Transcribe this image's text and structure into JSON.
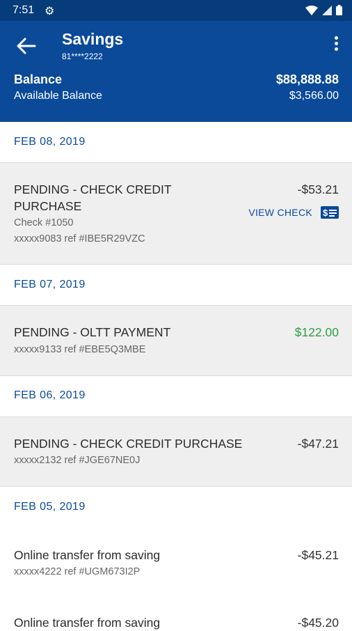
{
  "status": {
    "time": "7:51"
  },
  "header": {
    "title": "Savings",
    "account_masked": "81****2222",
    "balance_label": "Balance",
    "balance_value": "$88,888.88",
    "available_label": "Available Balance",
    "available_value": "$3,566.00"
  },
  "view_check_label": "VIEW CHECK",
  "groups": [
    {
      "date": "FEB 08, 2019",
      "transactions": [
        {
          "description_lines": [
            "PENDING - CHECK CREDIT",
            "PURCHASE"
          ],
          "check": "Check #1050",
          "ref": "xxxxx9083 ref #IBE5R29VZC",
          "amount": "-$53.21"
        }
      ]
    },
    {
      "date": "FEB 07, 2019",
      "transactions": [
        {
          "description": "PENDING - OLTT PAYMENT",
          "ref": "xxxxx9133 ref #EBE5Q3MBE",
          "amount": "$122.00"
        }
      ]
    },
    {
      "date": "FEB 06, 2019",
      "transactions": [
        {
          "description": "PENDING - CHECK CREDIT PURCHASE",
          "ref": "xxxxx2132 ref #JGE67NE0J",
          "amount": "-$47.21"
        }
      ]
    },
    {
      "date": "FEB 05, 2019",
      "transactions": [
        {
          "description": "Online transfer from saving",
          "ref": "xxxxx4222 ref #UGM673I2P",
          "amount": "-$45.21"
        },
        {
          "description": "Online transfer from saving",
          "amount": "-$45.20"
        }
      ]
    }
  ],
  "colors": {
    "header": "#0a4a99",
    "status_bar": "#063c7a",
    "credit": "#2f9e45"
  },
  "icons": {
    "back": "arrow-left-icon",
    "menu": "more-vertical-icon",
    "check": "check-card-icon",
    "settings": "gear-icon"
  }
}
